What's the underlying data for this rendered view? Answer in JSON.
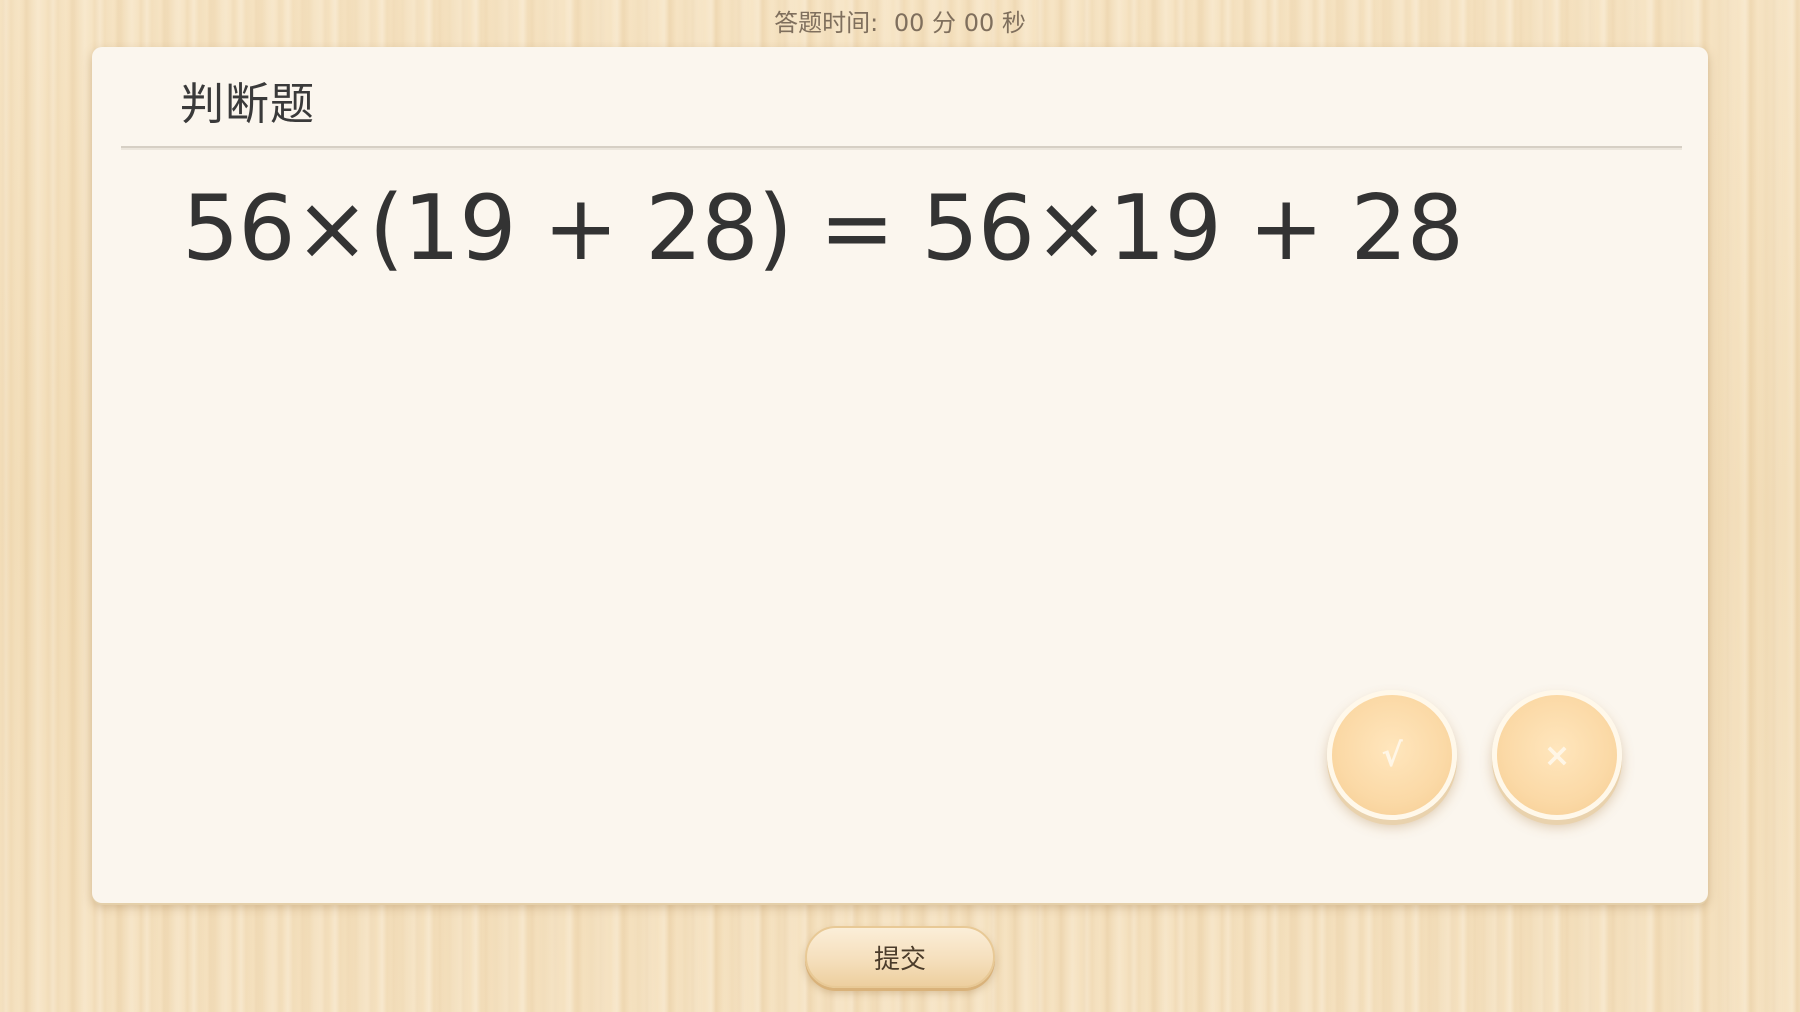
{
  "timer": {
    "label": "答题时间:",
    "minutes": "00",
    "minutes_unit": "分",
    "seconds": "00",
    "seconds_unit": "秒"
  },
  "card": {
    "title": "判断题",
    "question": "56×(19 + 28) = 56×19 + 28"
  },
  "answers": {
    "true_label": "√",
    "false_label": "×"
  },
  "submit": {
    "label": "提交"
  },
  "colors": {
    "background": "#f3dfbc",
    "card": "#fbf6ee",
    "answer_button": "#fbd9a6",
    "text": "#333333"
  }
}
